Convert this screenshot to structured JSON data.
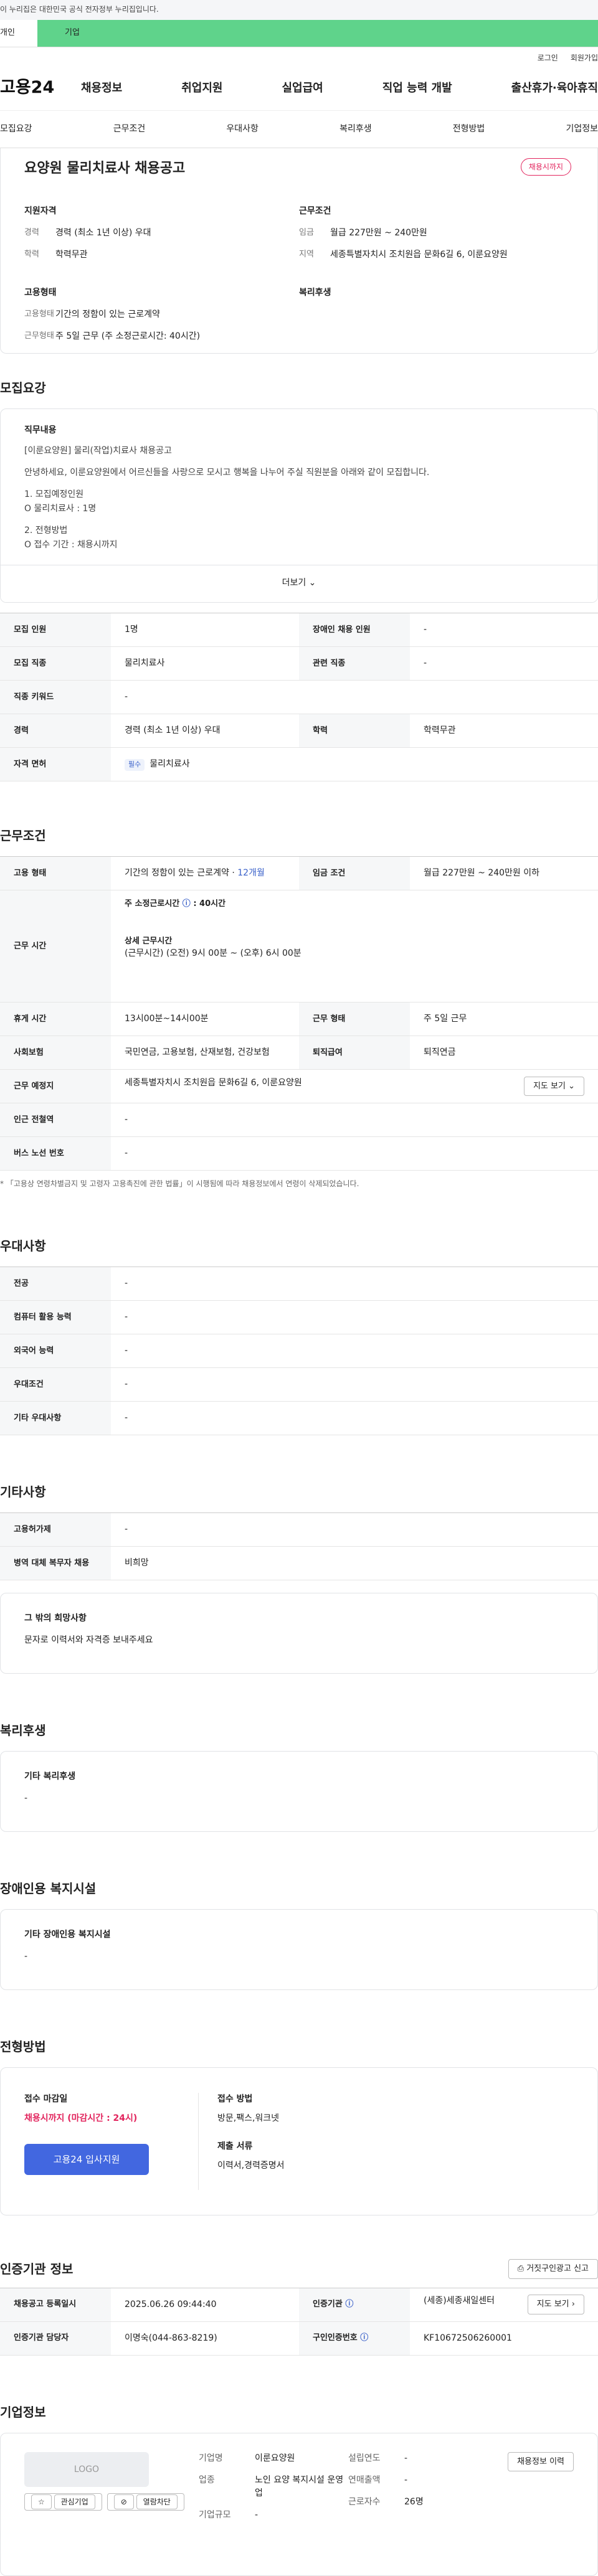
{
  "gov_bar": {
    "text": "이 누리집은 대한민국 공식 전자정부 누리집입니다."
  },
  "top_tabs": {
    "personal": "개인",
    "company": "기업"
  },
  "util": {
    "login": "로그인",
    "signup": "회원가입"
  },
  "gnb": {
    "logo": "고용24",
    "menu": [
      "채용정보",
      "취업지원",
      "실업급여",
      "직업 능력 개발",
      "출산휴가·육아휴직"
    ]
  },
  "subnav": [
    "모집요강",
    "근무조건",
    "우대사항",
    "복리후생",
    "전형방법",
    "기업정보"
  ],
  "summary": {
    "title": "요양원 물리치료사 채용공고",
    "status": "채용시까지",
    "qual": {
      "h": "지원자격",
      "rows": [
        {
          "k": "경력",
          "v": "경력 (최소 1년 이상) 우대"
        },
        {
          "k": "학력",
          "v": "학력무관"
        }
      ]
    },
    "cond": {
      "h": "근무조건",
      "rows": [
        {
          "k": "임금",
          "v": "월급 227만원 ~ 240만원"
        },
        {
          "k": "지역",
          "v": "세종특별자치시 조치원읍 문화6길 6, 이룬요양원"
        }
      ]
    },
    "emp": {
      "h": "고용형태",
      "rows": [
        {
          "k": "고용형태",
          "v": "기간의 정함이 있는 근로계약"
        },
        {
          "k": "근무형태",
          "v": "주 5일 근무 (주 소정근로시간: 40시간)"
        }
      ]
    },
    "welfare": {
      "h": "복리후생"
    }
  },
  "recruit": {
    "title": "모집요강",
    "detail_h": "직무내용",
    "lines": [
      "[이룬요양원] 물리(작업)치료사 채용공고",
      "안녕하세요, 이룬요양원에서 어르신들을 사랑으로 모시고 행복을 나누어 주실 직원분을 아래와 같이 모집합니다.",
      "1. 모집예정인원",
      "O 물리치료사 : 1명",
      "2. 전형방법",
      "O 접수 기간 : 채용시까지"
    ],
    "more": "더보기",
    "table": [
      [
        {
          "h": "모집 인원",
          "v": "1명"
        },
        {
          "h": "장애인 채용 인원",
          "v": "-"
        }
      ],
      [
        {
          "h": "모집 직종",
          "v": "물리치료사"
        },
        {
          "h": "관련 직종",
          "v": "-"
        }
      ],
      [
        {
          "h": "직종 키워드",
          "v": "-"
        }
      ],
      [
        {
          "h": "경력",
          "v": "경력 (최소 1년 이상) 우대"
        },
        {
          "h": "학력",
          "v": "학력무관"
        }
      ],
      [
        {
          "h": "자격 면허",
          "chip": "필수",
          "v": "물리치료사"
        }
      ]
    ]
  },
  "work": {
    "title": "근무조건",
    "emp_type": {
      "h": "고용 형태",
      "v": "기간의 정함이 있는 근로계약 · ",
      "v2": "12개월"
    },
    "wage": {
      "h": "임금 조건",
      "v": "월급 227만원 ~ 240만원 이하"
    },
    "hours": {
      "h": "근무 시간",
      "l1": "주 소정근로시간",
      "l1b": ": 40시간",
      "l2": "상세 근무시간",
      "l3": "(근무시간) (오전) 9시 00분 ~ (오후) 6시 00분"
    },
    "break": {
      "h": "휴게 시간",
      "v": "13시00분~14시00분"
    },
    "shape": {
      "h": "근무 형태",
      "v": "주 5일 근무"
    },
    "insurance": {
      "h": "사회보험",
      "v": "국민연금, 고용보험, 산재보험, 건강보험"
    },
    "retire": {
      "h": "퇴직급여",
      "v": "퇴직연금"
    },
    "place": {
      "h": "근무 예정지",
      "v": "세종특별자치시 조치원읍 문화6길 6, 이룬요양원",
      "btn": "지도 보기"
    },
    "subway": {
      "h": "인근 전철역",
      "v": "-"
    },
    "bus": {
      "h": "버스 노선 번호",
      "v": "-"
    },
    "note": "* 「고용상 연령차별금지 및 고령자 고용촉진에 관한 법률」이 시행됨에 따라 채용정보에서 연령이 삭제되었습니다."
  },
  "pref": {
    "title": "우대사항",
    "rows": [
      {
        "h": "전공",
        "v": "-"
      },
      {
        "h": "컴퓨터 활용 능력",
        "v": "-"
      },
      {
        "h": "외국어 능력",
        "v": "-"
      },
      {
        "h": "우대조건",
        "v": "-"
      },
      {
        "h": "기타 우대사항",
        "v": "-"
      }
    ]
  },
  "etc": {
    "title": "기타사항",
    "rows": [
      {
        "h": "고용허가제",
        "v": "-"
      },
      {
        "h": "병역 대체 복무자 채용",
        "v": "비희망"
      }
    ],
    "box_h": "그 밖의 희망사항",
    "box_v": "문자로 이력서와 자격증 보내주세요"
  },
  "welfare": {
    "title": "복리후생",
    "h": "기타 복리후생",
    "v": "-"
  },
  "disability": {
    "title": "장애인용 복지시설",
    "h": "기타 장애인용 복지시설",
    "v": "-"
  },
  "process": {
    "title": "전형방법",
    "deadline_h": "접수 마감일",
    "deadline": "채용시까지 (마감시간 : 24시)",
    "apply_btn": "고용24 입사지원",
    "method_h": "접수 방법",
    "method": "방문,팩스,워크넷",
    "docs_h": "제출 서류",
    "docs": "이력서,경력증명서"
  },
  "agency": {
    "title": "인증기관 정보",
    "report_btn": "거짓구인광고 신고",
    "rows": [
      [
        {
          "h": "채용공고 등록일시",
          "v": "2025.06.26 09:44:40"
        },
        {
          "h": "인증기관",
          "v": "(세종)세종새일센터",
          "btn": "지도 보기"
        }
      ],
      [
        {
          "h": "인증기관 담당자",
          "v": "이명숙(044-863-8219)"
        },
        {
          "h": "구인인증번호",
          "v": "KF10672506260001"
        }
      ]
    ]
  },
  "company": {
    "title": "기업정보",
    "logo": "LOGO",
    "fav": "관심기업",
    "block": "열람차단",
    "name_k": "기업명",
    "name": "이룬요양원",
    "biz_k": "업종",
    "biz": "노인 요양 복지시설 운영업",
    "size_k": "기업규모",
    "size": "-",
    "year_k": "설립연도",
    "year": "-",
    "sales_k": "연매출액",
    "sales": "-",
    "emp_k": "근로자수",
    "emp": "26명",
    "history_btn": "채용정보 이력"
  }
}
